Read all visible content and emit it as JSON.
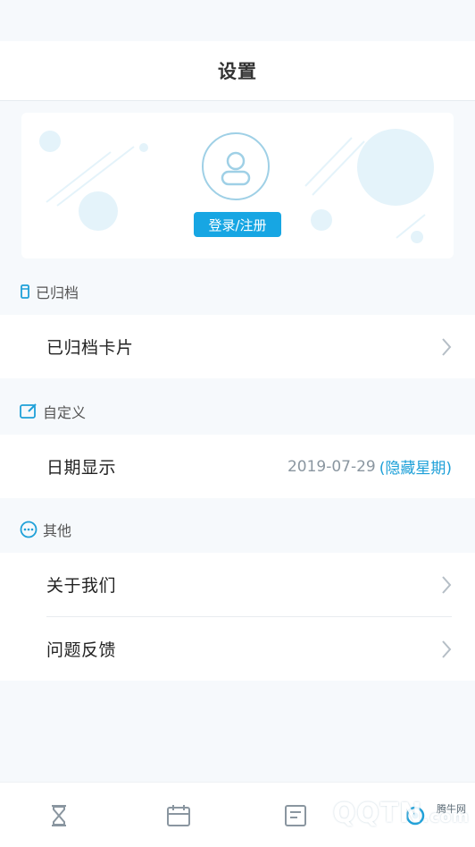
{
  "header": {
    "title": "设置"
  },
  "profile": {
    "login_label": "登录/注册"
  },
  "sections": {
    "archived": {
      "label": "已归档",
      "items": [
        {
          "label": "已归档卡片"
        }
      ]
    },
    "custom": {
      "label": "自定义",
      "items": [
        {
          "label": "日期显示",
          "value": "2019-07-29",
          "value_accent": "(隐藏星期)"
        }
      ]
    },
    "other": {
      "label": "其他",
      "items": [
        {
          "label": "关于我们"
        },
        {
          "label": "问题反馈"
        }
      ]
    }
  },
  "watermark": {
    "text": "QQTN",
    "suffix": ".com",
    "small": "腾牛网"
  },
  "colors": {
    "accent": "#17a6e3",
    "avatar_ring": "#9fd0e6",
    "background": "#f6f9fc"
  }
}
